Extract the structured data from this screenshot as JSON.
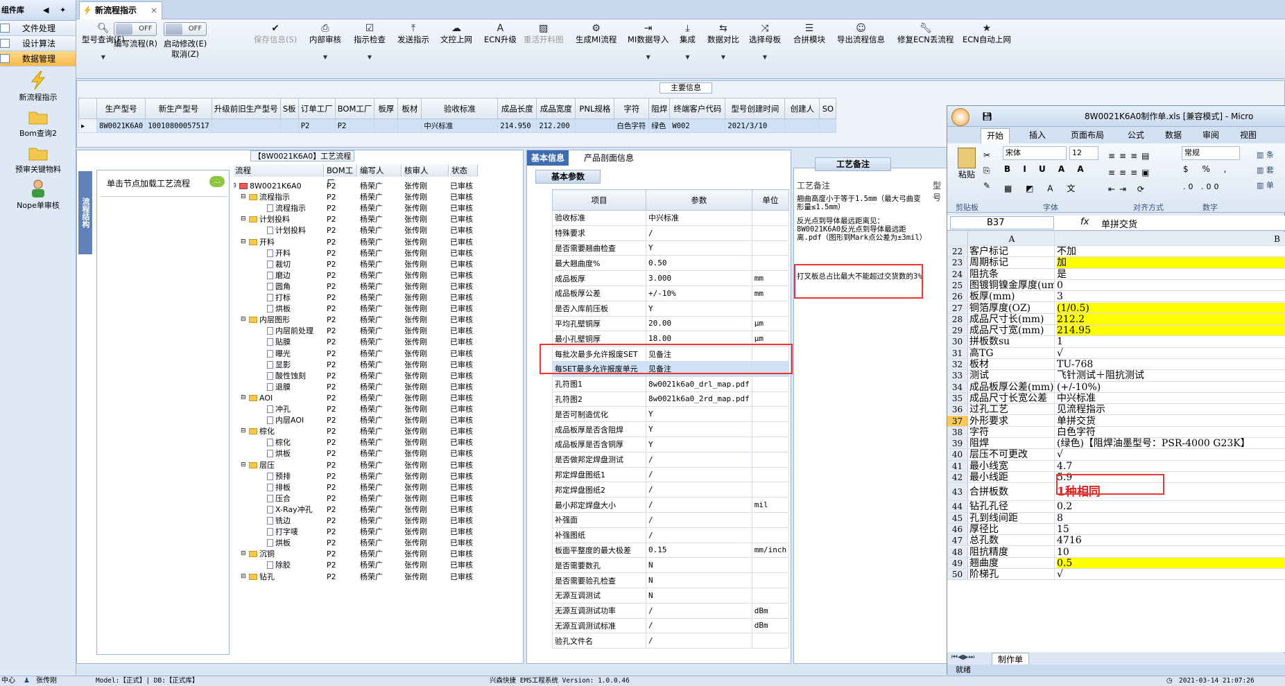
{
  "left_nav": {
    "title": "组件库",
    "items": [
      {
        "label": "文件处理",
        "active": false
      },
      {
        "label": "设计算法",
        "active": false
      },
      {
        "label": "数据管理",
        "active": true
      }
    ],
    "tools": [
      "新流程指示",
      "Bom查询2",
      "预审关键物料",
      "Nope单审核"
    ]
  },
  "tab": {
    "title": "新流程指示"
  },
  "toolbar": {
    "model_query": "型号查询(F)",
    "edit_flow_toggle": "OFF",
    "edit_flow_label": "编写流程(R)",
    "auto_modify_toggle": "OFF",
    "auto_modify_label1": "启动修改(E)",
    "auto_modify_label2": "取消(Z)",
    "items": [
      "保存信息(S)",
      "内部审核",
      "指示检查",
      "发送指示",
      "文控上网",
      "ECN升级",
      "重活开料图",
      "生成MI流程",
      "MI数据导入",
      "集成",
      "数据对比",
      "选择母板",
      "合拼模块",
      "导出流程信息",
      "修复ECN丢流程",
      "ECN自动上网"
    ]
  },
  "main_info": {
    "title": "主要信息",
    "columns": [
      "生产型号",
      "新生产型号",
      "升级前旧生产型号",
      "S板",
      "订单工厂",
      "BOM工厂",
      "板厚",
      "板材",
      "验收标准",
      "成品长度",
      "成品宽度",
      "PNL规格",
      "字符",
      "阻焊",
      "终端客户代码",
      "型号创建时间",
      "创建人",
      "SO"
    ],
    "row": [
      "8W0021K6A0",
      "10010800057517",
      "",
      "",
      "P2",
      "P2",
      "",
      "",
      "中兴标准",
      "214.950",
      "212.200",
      "",
      "白色字符",
      "绿色",
      "W002",
      "2021/3/10",
      "",
      ""
    ]
  },
  "process": {
    "title": "【8W0021K6A0】工艺流程",
    "side_tab": "流程结构",
    "node_hint": "单击节点加载工艺流程",
    "columns": [
      "流程",
      "BOM工厂",
      "编写人",
      "核审人",
      "状态"
    ],
    "rows": [
      {
        "name": "8W0021K6A0",
        "level": 0,
        "type": "root",
        "bom": "P2",
        "writer": "杨荣广",
        "reviewer": "张传刚",
        "status": "已审核"
      },
      {
        "name": "流程指示",
        "level": 1,
        "type": "folder",
        "bom": "P2",
        "writer": "杨荣广",
        "reviewer": "张传刚",
        "status": "已审核"
      },
      {
        "name": "流程指示",
        "level": 2,
        "type": "doc",
        "bom": "P2",
        "writer": "杨荣广",
        "reviewer": "张传刚",
        "status": "已审核"
      },
      {
        "name": "计划投料",
        "level": 1,
        "type": "folder",
        "bom": "P2",
        "writer": "杨荣广",
        "reviewer": "张传刚",
        "status": "已审核"
      },
      {
        "name": "计划投料",
        "level": 2,
        "type": "doc",
        "bom": "P2",
        "writer": "杨荣广",
        "reviewer": "张传刚",
        "status": "已审核"
      },
      {
        "name": "开料",
        "level": 1,
        "type": "folder",
        "bom": "P2",
        "writer": "杨荣广",
        "reviewer": "张传刚",
        "status": "已审核"
      },
      {
        "name": "开料",
        "level": 2,
        "type": "doc",
        "bom": "P2",
        "writer": "杨荣广",
        "reviewer": "张传刚",
        "status": "已审核"
      },
      {
        "name": "裁切",
        "level": 2,
        "type": "doc",
        "bom": "P2",
        "writer": "杨荣广",
        "reviewer": "张传刚",
        "status": "已审核"
      },
      {
        "name": "磨边",
        "level": 2,
        "type": "doc",
        "bom": "P2",
        "writer": "杨荣广",
        "reviewer": "张传刚",
        "status": "已审核"
      },
      {
        "name": "圆角",
        "level": 2,
        "type": "doc",
        "bom": "P2",
        "writer": "杨荣广",
        "reviewer": "张传刚",
        "status": "已审核"
      },
      {
        "name": "打标",
        "level": 2,
        "type": "doc",
        "bom": "P2",
        "writer": "杨荣广",
        "reviewer": "张传刚",
        "status": "已审核"
      },
      {
        "name": "烘板",
        "level": 2,
        "type": "doc",
        "bom": "P2",
        "writer": "杨荣广",
        "reviewer": "张传刚",
        "status": "已审核"
      },
      {
        "name": "内层图形",
        "level": 1,
        "type": "folder",
        "bom": "P2",
        "writer": "杨荣广",
        "reviewer": "张传刚",
        "status": "已审核"
      },
      {
        "name": "内层前处理",
        "level": 2,
        "type": "doc",
        "bom": "P2",
        "writer": "杨荣广",
        "reviewer": "张传刚",
        "status": "已审核"
      },
      {
        "name": "贴膜",
        "level": 2,
        "type": "doc",
        "bom": "P2",
        "writer": "杨荣广",
        "reviewer": "张传刚",
        "status": "已审核"
      },
      {
        "name": "曝光",
        "level": 2,
        "type": "doc",
        "bom": "P2",
        "writer": "杨荣广",
        "reviewer": "张传刚",
        "status": "已审核"
      },
      {
        "name": "显影",
        "level": 2,
        "type": "doc",
        "bom": "P2",
        "writer": "杨荣广",
        "reviewer": "张传刚",
        "status": "已审核"
      },
      {
        "name": "酸性蚀刻",
        "level": 2,
        "type": "doc",
        "bom": "P2",
        "writer": "杨荣广",
        "reviewer": "张传刚",
        "status": "已审核"
      },
      {
        "name": "退膜",
        "level": 2,
        "type": "doc",
        "bom": "P2",
        "writer": "杨荣广",
        "reviewer": "张传刚",
        "status": "已审核"
      },
      {
        "name": "AOI",
        "level": 1,
        "type": "folder",
        "bom": "P2",
        "writer": "杨荣广",
        "reviewer": "张传刚",
        "status": "已审核"
      },
      {
        "name": "冲孔",
        "level": 2,
        "type": "doc",
        "bom": "P2",
        "writer": "杨荣广",
        "reviewer": "张传刚",
        "status": "已审核"
      },
      {
        "name": "内层AOI",
        "level": 2,
        "type": "doc",
        "bom": "P2",
        "writer": "杨荣广",
        "reviewer": "张传刚",
        "status": "已审核"
      },
      {
        "name": "棕化",
        "level": 1,
        "type": "folder",
        "bom": "P2",
        "writer": "杨荣广",
        "reviewer": "张传刚",
        "status": "已审核"
      },
      {
        "name": "棕化",
        "level": 2,
        "type": "doc",
        "bom": "P2",
        "writer": "杨荣广",
        "reviewer": "张传刚",
        "status": "已审核"
      },
      {
        "name": "烘板",
        "level": 2,
        "type": "doc",
        "bom": "P2",
        "writer": "杨荣广",
        "reviewer": "张传刚",
        "status": "已审核"
      },
      {
        "name": "层压",
        "level": 1,
        "type": "folder",
        "bom": "P2",
        "writer": "杨荣广",
        "reviewer": "张传刚",
        "status": "已审核"
      },
      {
        "name": "预排",
        "level": 2,
        "type": "doc",
        "bom": "P2",
        "writer": "杨荣广",
        "reviewer": "张传刚",
        "status": "已审核"
      },
      {
        "name": "排板",
        "level": 2,
        "type": "doc",
        "bom": "P2",
        "writer": "杨荣广",
        "reviewer": "张传刚",
        "status": "已审核"
      },
      {
        "name": "压合",
        "level": 2,
        "type": "doc",
        "bom": "P2",
        "writer": "杨荣广",
        "reviewer": "张传刚",
        "status": "已审核"
      },
      {
        "name": "X-Ray冲孔",
        "level": 2,
        "type": "doc",
        "bom": "P2",
        "writer": "杨荣广",
        "reviewer": "张传刚",
        "status": "已审核"
      },
      {
        "name": "铣边",
        "level": 2,
        "type": "doc",
        "bom": "P2",
        "writer": "杨荣广",
        "reviewer": "张传刚",
        "status": "已审核"
      },
      {
        "name": "打字唛",
        "level": 2,
        "type": "doc",
        "bom": "P2",
        "writer": "杨荣广",
        "reviewer": "张传刚",
        "status": "已审核"
      },
      {
        "name": "烘板",
        "level": 2,
        "type": "doc",
        "bom": "P2",
        "writer": "杨荣广",
        "reviewer": "张传刚",
        "status": "已审核"
      },
      {
        "name": "沉铜",
        "level": 1,
        "type": "folder",
        "bom": "P2",
        "writer": "杨荣广",
        "reviewer": "张传刚",
        "status": "已审核"
      },
      {
        "name": "除胶",
        "level": 2,
        "type": "doc",
        "bom": "P2",
        "writer": "杨荣广",
        "reviewer": "张传刚",
        "status": "已审核"
      },
      {
        "name": "钻孔",
        "level": 1,
        "type": "folder",
        "bom": "P2",
        "writer": "杨荣广",
        "reviewer": "张传刚",
        "status": "已审核"
      }
    ]
  },
  "basic": {
    "tabs": [
      "基本信息",
      "产品剖面信息"
    ],
    "subtab": "基本参数",
    "columns": [
      "项目",
      "参数",
      "单位"
    ],
    "rows": [
      [
        "验收标准",
        "中兴标准",
        ""
      ],
      [
        "特殊要求",
        "/",
        ""
      ],
      [
        "是否需要翘曲检查",
        "Y",
        ""
      ],
      [
        "最大翘曲度%",
        "0.50",
        ""
      ],
      [
        "成品板厚",
        "3.000",
        "mm"
      ],
      [
        "成品板厚公差",
        "+/-10%",
        "mm"
      ],
      [
        "是否入库前压板",
        "Y",
        ""
      ],
      [
        "平均孔壁铜厚",
        "20.00",
        "μm"
      ],
      [
        "最小孔壁铜厚",
        "18.00",
        "μm"
      ],
      [
        "每批次最多允许报废SET",
        "见备注",
        ""
      ],
      [
        "每SET最多允许报废单元",
        "见备注",
        ""
      ],
      [
        "孔符图1",
        "8w0021k6a0_drl_map.pdf",
        ""
      ],
      [
        "孔符图2",
        "8w0021k6a0_2rd_map.pdf",
        ""
      ],
      [
        "是否可制造优化",
        "Y",
        ""
      ],
      [
        "成品板厚是否含阻焊",
        "Y",
        ""
      ],
      [
        "成品板厚是否含铜厚",
        "Y",
        ""
      ],
      [
        "是否做邦定焊盘测试",
        "/",
        ""
      ],
      [
        "邦定焊盘图纸1",
        "/",
        ""
      ],
      [
        "邦定焊盘图纸2",
        "/",
        ""
      ],
      [
        "最小邦定焊盘大小",
        "/",
        "mil"
      ],
      [
        "补强面",
        "/",
        ""
      ],
      [
        "补强图纸",
        "/",
        ""
      ],
      [
        "板面平整度的最大极差",
        "0.15",
        "mm/inch"
      ],
      [
        "是否需要数孔",
        "N",
        ""
      ],
      [
        "是否需要验孔检查",
        "N",
        ""
      ],
      [
        "无源互调测试",
        "N",
        ""
      ],
      [
        "无源互调测试功率",
        "/",
        "dBm"
      ],
      [
        "无源互调测试标准",
        "/",
        "dBm"
      ],
      [
        "验孔文件名",
        "/",
        ""
      ]
    ]
  },
  "craft_note": {
    "tab": "工艺备注",
    "header": "工艺备注",
    "side_label": "型号",
    "lines": [
      "翘曲高度小于等于1.5mm（最大弓曲变形量≤1.5mm）",
      "反光点到导体最远距离见：8W0021K6A0反光点到导体最远距离.pdf（图形到Mark点公差为±3mil）",
      "打叉板总占比最大不能超过交货数的3%"
    ]
  },
  "excel": {
    "title": "8W0021K6A0制作单.xls [兼容模式] - Micro",
    "tabs": [
      "开始",
      "插入",
      "页面布局",
      "公式",
      "数据",
      "审阅",
      "视图"
    ],
    "font_name": "宋体",
    "font_size": "12",
    "number_format": "常规",
    "groups": [
      "剪贴板",
      "字体",
      "对齐方式",
      "数字"
    ],
    "paste_label": "粘贴",
    "cell_ref": "B37",
    "formula": "单拼交货",
    "col_a": "A",
    "col_b": "B",
    "rows": [
      {
        "n": "22",
        "a": "客户标记",
        "b": "不加",
        "y": false,
        "big": false
      },
      {
        "n": "23",
        "a": "周期标记",
        "b": "加",
        "y": true,
        "big": false
      },
      {
        "n": "24",
        "a": "阻抗条",
        "b": "是",
        "y": false,
        "big": false
      },
      {
        "n": "25",
        "a": "图镀铜镍金厚度(um)",
        "b": "0",
        "y": false,
        "big": false
      },
      {
        "n": "26",
        "a": "板厚(mm)",
        "b": "3",
        "y": false,
        "big": false
      },
      {
        "n": "27",
        "a": "铜箔厚度(OZ)",
        "b": "(1/0.5)",
        "y": true,
        "big": false
      },
      {
        "n": "28",
        "a": "成品尺寸长(mm)",
        "b": "212.2",
        "y": true,
        "big": false
      },
      {
        "n": "29",
        "a": "成品尺寸宽(mm)",
        "b": "214.95",
        "y": true,
        "big": false
      },
      {
        "n": "30",
        "a": "拼板数su",
        "b": "1",
        "y": false,
        "big": false
      },
      {
        "n": "31",
        "a": "高TG",
        "b": "√",
        "y": false,
        "big": false
      },
      {
        "n": "32",
        "a": "板材",
        "b": "TU-768",
        "y": false,
        "big": false
      },
      {
        "n": "33",
        "a": "测试",
        "b": "飞针测试＋阻抗测试",
        "y": false,
        "big": false
      },
      {
        "n": "34",
        "a": "成品板厚公差(mm)",
        "b": "(+/-10%)",
        "y": false,
        "big": false
      },
      {
        "n": "35",
        "a": "成品尺寸长宽公差",
        "b": "中兴标准",
        "y": false,
        "big": false
      },
      {
        "n": "36",
        "a": "过孔工艺",
        "b": "见流程指示",
        "y": false,
        "big": false
      },
      {
        "n": "37",
        "a": "外形要求",
        "b": "单拼交货",
        "y": false,
        "big": false
      },
      {
        "n": "38",
        "a": "字符",
        "b": "白色字符",
        "y": false,
        "big": false
      },
      {
        "n": "39",
        "a": "阻焊",
        "b": "(绿色)【阻焊油墨型号：PSR-4000 G23K】",
        "y": false,
        "big": false
      },
      {
        "n": "40",
        "a": "层压不可更改",
        "b": "√",
        "y": false,
        "big": false
      },
      {
        "n": "41",
        "a": "最小线宽",
        "b": "4.7",
        "y": false,
        "big": false
      },
      {
        "n": "42",
        "a": "最小线距",
        "b": "5.9",
        "y": false,
        "big": false
      },
      {
        "n": "43",
        "a": "合拼板数",
        "b": "1种相同",
        "y": false,
        "big": true
      },
      {
        "n": "44",
        "a": "钻孔孔径",
        "b": "0.2",
        "y": false,
        "big": false
      },
      {
        "n": "45",
        "a": "孔到线间距",
        "b": "8",
        "y": false,
        "big": false
      },
      {
        "n": "46",
        "a": "厚径比",
        "b": "15",
        "y": false,
        "big": false
      },
      {
        "n": "47",
        "a": "总孔数",
        "b": "4716",
        "y": false,
        "big": false
      },
      {
        "n": "48",
        "a": "阻抗精度",
        "b": "10",
        "y": false,
        "big": false
      },
      {
        "n": "49",
        "a": "翘曲度",
        "b": "0.5",
        "y": true,
        "big": false
      },
      {
        "n": "50",
        "a": "阶梯孔",
        "b": "√",
        "y": false,
        "big": false
      }
    ],
    "sheet_tab": "制作单",
    "status": "就绪"
  },
  "status_bar": {
    "left": "中心",
    "user": "张传刚",
    "model": "Model:【正式】| DB:【正式库】",
    "system": "兴森快捷 EMS工程系统 Version: 1.0.0.46",
    "datetime": "2021-03-14 21:07:26"
  }
}
